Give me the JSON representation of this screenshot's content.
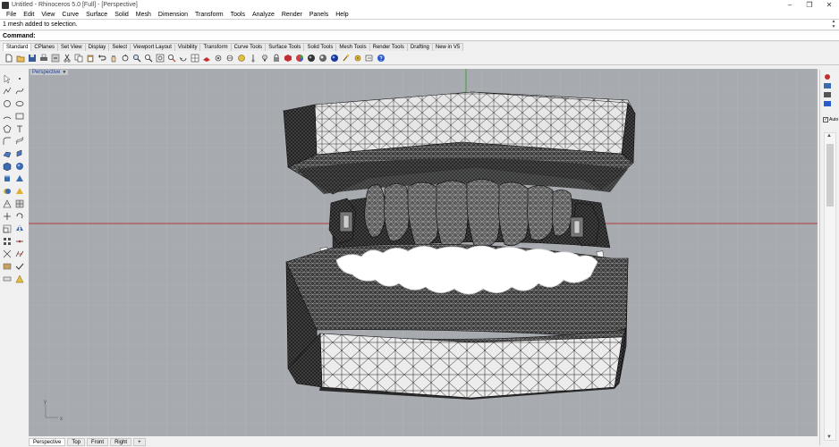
{
  "window": {
    "title": "Untitled - Rhinoceros 5.0 [Full] - [Perspective]",
    "minimize": "–",
    "maximize": "❐",
    "close": "✕"
  },
  "menu": [
    "File",
    "Edit",
    "View",
    "Curve",
    "Surface",
    "Solid",
    "Mesh",
    "Dimension",
    "Transform",
    "Tools",
    "Analyze",
    "Render",
    "Panels",
    "Help"
  ],
  "command": {
    "history": "1 mesh added to selection.",
    "label": "Command:",
    "value": ""
  },
  "toolbar_tabs": [
    "Standard",
    "CPlanes",
    "Set View",
    "Display",
    "Select",
    "Viewport Layout",
    "Visibility",
    "Transform",
    "Curve Tools",
    "Surface Tools",
    "Solid Tools",
    "Mesh Tools",
    "Render Tools",
    "Drafting",
    "New in V5"
  ],
  "toolbar_icons": [
    "new-file-icon",
    "open-file-icon",
    "save-icon",
    "print-icon",
    "import-icon",
    "cut-icon",
    "copy-icon",
    "paste-icon",
    "undo-icon",
    "pan-icon",
    "rotate-view-icon",
    "zoom-icon",
    "zoom-window-icon",
    "zoom-extents-icon",
    "zoom-selected-icon",
    "undo-view-icon",
    "four-viewports-icon",
    "construction-plane-icon",
    "object-snap-icon",
    "grid-snap-icon",
    "properties-icon",
    "layer-icon",
    "light-icon",
    "lock-icon",
    "material-icon",
    "render-color-icon",
    "sphere-render-icon",
    "render-icon",
    "environment-icon",
    "options-icon",
    "tools-icon",
    "dimension-icon",
    "help-icon"
  ],
  "viewport": {
    "title": "Perspective",
    "axis_x": "x",
    "axis_y": "y"
  },
  "view_tabs": [
    "Perspective",
    "Top",
    "Front",
    "Right",
    "+"
  ],
  "right_panel": {
    "auto_label": "Auto"
  },
  "colors": {
    "viewport_bg": "#a7abb0",
    "x_axis": "#b23a3a",
    "y_axis": "#3a9a3a",
    "mesh_surface": "#e8e8e8",
    "mesh_dark": "#1a1a1a",
    "teeth": "#ffffff"
  }
}
